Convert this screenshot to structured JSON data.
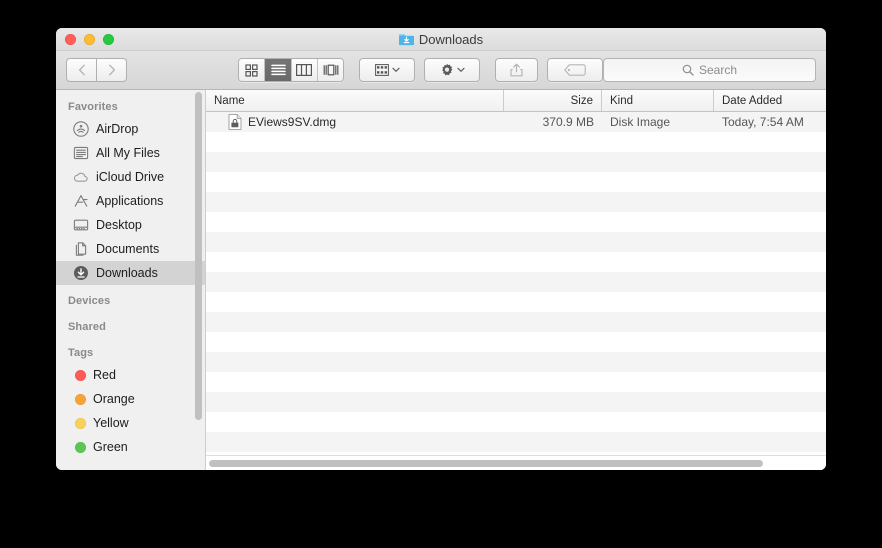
{
  "window": {
    "title": "Downloads",
    "title_icon": "downloads-folder-icon",
    "traffic_lights": [
      {
        "name": "close-button",
        "color": "#ff5f57"
      },
      {
        "name": "minimize-button",
        "color": "#febc2e"
      },
      {
        "name": "maximize-button",
        "color": "#28c840"
      }
    ]
  },
  "toolbar": {
    "back_icon": "chevron-left-icon",
    "forward_icon": "chevron-right-icon",
    "view_modes": [
      {
        "name": "icon-view",
        "icon": "grid-icon",
        "selected": false
      },
      {
        "name": "list-view",
        "icon": "list-icon",
        "selected": true
      },
      {
        "name": "column-view",
        "icon": "columns-icon",
        "selected": false
      },
      {
        "name": "coverflow-view",
        "icon": "coverflow-icon",
        "selected": false
      }
    ],
    "arrange_icon": "arrange-grid-icon",
    "action_icon": "gear-icon",
    "share_icon": "share-icon",
    "tag_icon": "tag-icon",
    "dropdown_icon": "chevron-down-icon"
  },
  "search": {
    "placeholder": "Search",
    "value": "",
    "icon": "search-icon"
  },
  "sidebar": {
    "sections": [
      {
        "header": "Favorites",
        "items": [
          {
            "label": "AirDrop",
            "icon": "airdrop-icon",
            "selected": false
          },
          {
            "label": "All My Files",
            "icon": "all-my-files-icon",
            "selected": false
          },
          {
            "label": "iCloud Drive",
            "icon": "icloud-icon",
            "selected": false
          },
          {
            "label": "Applications",
            "icon": "applications-icon",
            "selected": false
          },
          {
            "label": "Desktop",
            "icon": "desktop-icon",
            "selected": false
          },
          {
            "label": "Documents",
            "icon": "documents-icon",
            "selected": false
          },
          {
            "label": "Downloads",
            "icon": "downloads-icon",
            "selected": true
          }
        ]
      },
      {
        "header": "Devices",
        "items": []
      },
      {
        "header": "Shared",
        "items": []
      },
      {
        "header": "Tags",
        "items": [
          {
            "label": "Red",
            "icon": "tag-dot",
            "color": "#fc5b57",
            "selected": false
          },
          {
            "label": "Orange",
            "icon": "tag-dot",
            "color": "#f6a33a",
            "selected": false
          },
          {
            "label": "Yellow",
            "icon": "tag-dot",
            "color": "#f8d15b",
            "selected": false
          },
          {
            "label": "Green",
            "icon": "tag-dot",
            "color": "#5fc454",
            "selected": false
          }
        ]
      }
    ]
  },
  "file_list": {
    "columns": [
      {
        "key": "name",
        "label": "Name"
      },
      {
        "key": "size",
        "label": "Size"
      },
      {
        "key": "kind",
        "label": "Kind"
      },
      {
        "key": "date",
        "label": "Date Added"
      }
    ],
    "rows": [
      {
        "name": "EViews9SV.dmg",
        "size": "370.9 MB",
        "kind": "Disk Image",
        "date": "Today, 7:54 AM",
        "icon": "disk-image-file-icon"
      }
    ],
    "empty_row_count": 17
  }
}
